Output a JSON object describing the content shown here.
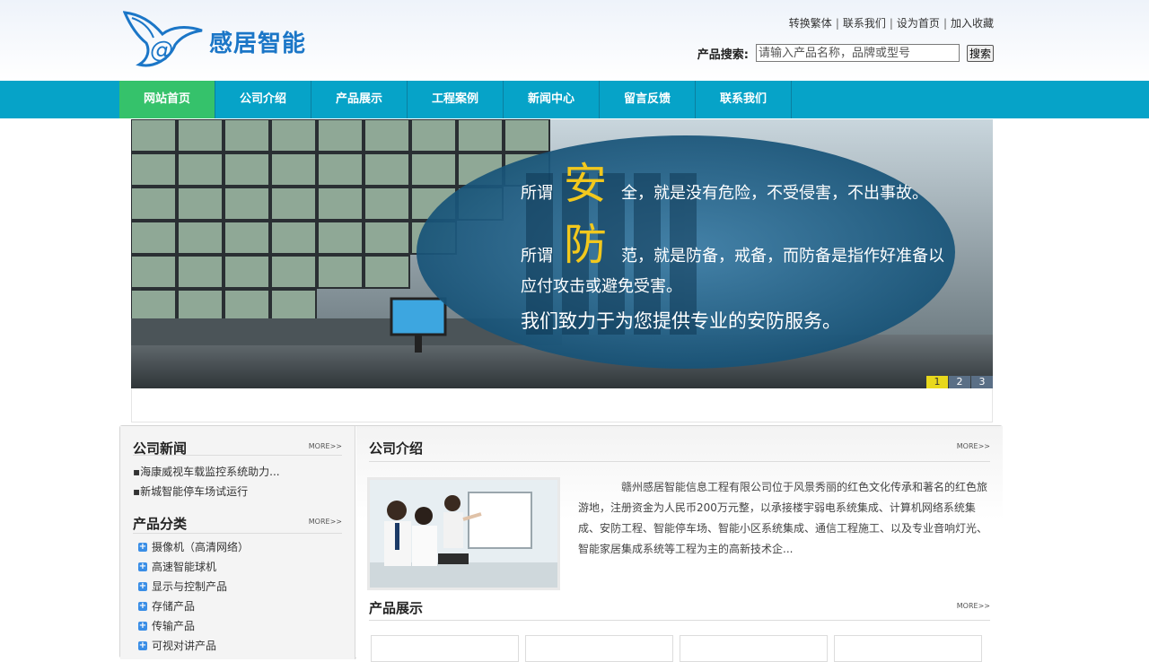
{
  "header": {
    "logo_text": "感居智能",
    "top_links": [
      "转换繁体",
      "联系我们",
      "设为首页",
      "加入收藏"
    ],
    "search_label": "产品搜索:",
    "search_placeholder": "请输入产品名称，品牌或型号",
    "search_button": "搜索"
  },
  "nav": {
    "items": [
      "网站首页",
      "公司介绍",
      "产品展示",
      "工程案例",
      "新闻中心",
      "留言反馈",
      "联系我们"
    ],
    "active_index": 0
  },
  "banner": {
    "line1_pre": "所谓",
    "line1_big": "安",
    "line1_post": "全，就是没有危险，不受侵害，不出事故。",
    "line2_pre": "所谓",
    "line2_big": "防",
    "line2_post": "范，就是防备，戒备，而防备是指作好准备以",
    "line3": "应付攻击或避免受害。",
    "line4": "我们致力于为您提供专业的安防服务。",
    "dots": [
      "1",
      "2",
      "3"
    ],
    "active_dot": 0
  },
  "left": {
    "news_title": "公司新闻",
    "news_more": "MORE>>",
    "news_items": [
      "▪海康威视车载监控系统助力...",
      "▪新城智能停车场试运行"
    ],
    "cat_title": "产品分类",
    "cat_more": "MORE>>",
    "cat_items": [
      "摄像机（高清网络）",
      "高速智能球机",
      "显示与控制产品",
      "存储产品",
      "传输产品",
      "可视对讲产品"
    ]
  },
  "right": {
    "intro_title": "公司介绍",
    "intro_more": "MORE>>",
    "intro_text": "赣州感居智能信息工程有限公司位于风景秀丽的红色文化传承和著名的红色旅游地，注册资金为人民币200万元整，以承接楼宇弱电系统集成、计算机网络系统集成、安防工程、智能停车场、智能小区系统集成、通信工程施工、以及专业音响灯光、智能家居集成系统等工程为主的高新技术企...",
    "products_title": "产品展示",
    "products_more": "MORE>>"
  },
  "colors": {
    "nav_bg": "#06a3c8",
    "nav_active": "#35c26b",
    "logo_blue": "#1b76c7",
    "banner_highlight": "#f2c81d"
  }
}
